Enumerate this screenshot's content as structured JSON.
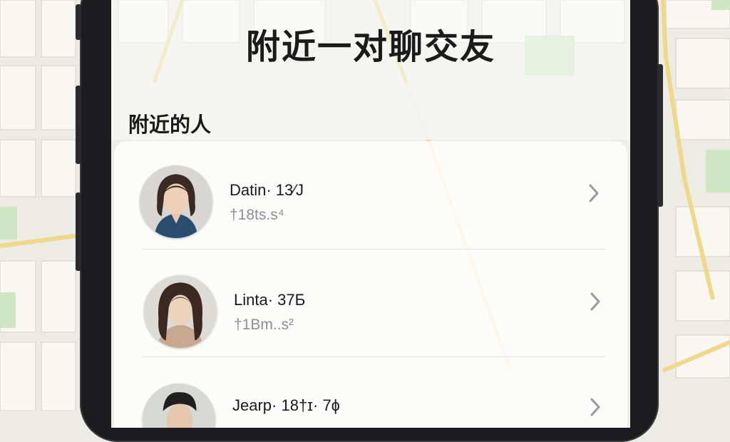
{
  "header": {
    "title": "附近一对聊交友"
  },
  "section": {
    "title": "附近的人"
  },
  "people": [
    {
      "name": "Datin· 13⁄J",
      "sub": "†18ts.s⁴"
    },
    {
      "name": "Linta· 37Ƃ",
      "sub": "†1Bm..s²"
    },
    {
      "name": "Jearp· 18†ɪ· 7ɸ",
      "sub": ""
    }
  ],
  "colors": {
    "map_base": "#ecebe4",
    "map_block": "#f7f6f0",
    "map_road_major": "#f3da8c",
    "map_park": "#cfe6c4",
    "phone_frame": "#1c1c1e",
    "chevron": "#9a9a9a"
  }
}
